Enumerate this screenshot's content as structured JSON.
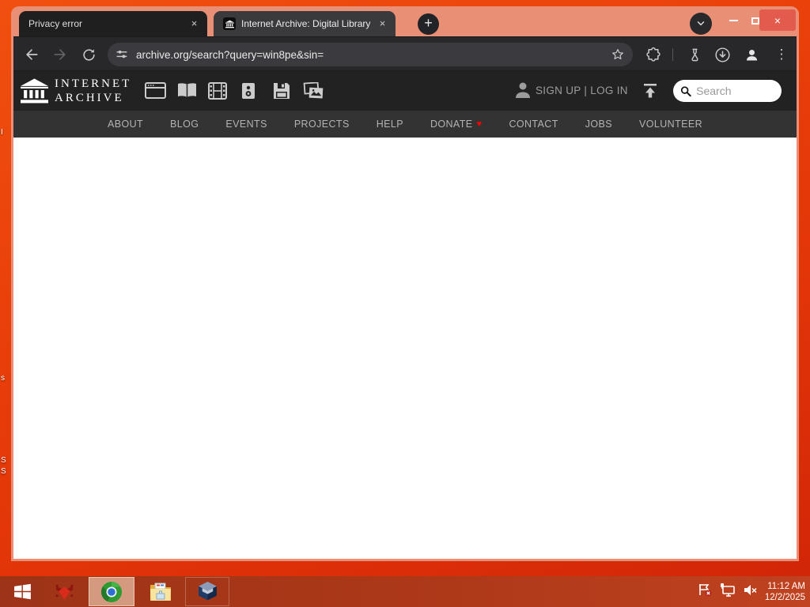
{
  "browser": {
    "tab1": {
      "title": "Privacy error"
    },
    "tab2": {
      "title": "Internet Archive: Digital Library"
    },
    "url": "archive.org/search?query=win8pe&sin="
  },
  "ia_header": {
    "logo_line1": "INTERNET",
    "logo_line2": "ARCHIVE",
    "auth": "SIGN UP | LOG IN",
    "search_placeholder": "Search"
  },
  "nav": {
    "items": [
      "ABOUT",
      "BLOG",
      "EVENTS",
      "PROJECTS",
      "HELP",
      "DONATE",
      "CONTACT",
      "JOBS",
      "VOLUNTEER"
    ]
  },
  "taskbar": {
    "time": "11:12 AM",
    "date": "12/2/2025"
  },
  "desktop": {
    "fragments": [
      "I",
      "s",
      "S",
      "S"
    ]
  },
  "icons": {
    "close": "×",
    "plus": "+",
    "menu_dots": "⋮",
    "heart": "♥"
  },
  "colors": {
    "frame_salmon": "#e88f76",
    "desktop_orange": "#e8430c",
    "taskbar_red": "#a83918",
    "close_button_red": "#e25b4d",
    "active_tab_gray": "#3a3a3d",
    "toolbar_gray": "#28282b",
    "ia_header_black": "#222222",
    "ia_nav_gray": "#333333",
    "donate_heart_red": "#ff0000"
  }
}
